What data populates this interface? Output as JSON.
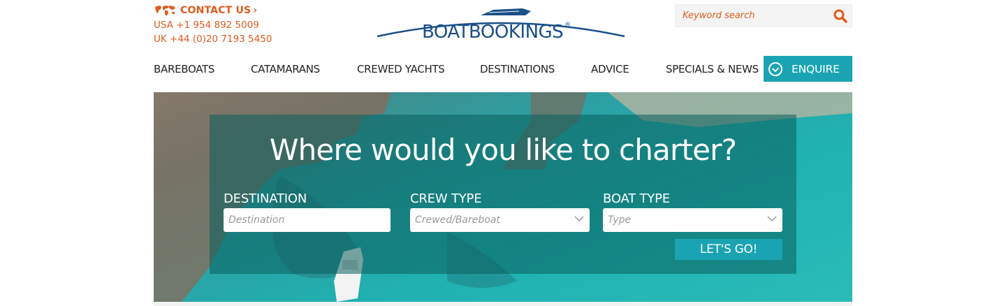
{
  "contact": {
    "icon": "world-map-icon",
    "label": "CONTACT US",
    "chevron": "›",
    "phone_usa": "USA +1 954 892 5009",
    "phone_uk": "UK +44 (0)20 7193 5450",
    "color": "#e05a1f"
  },
  "logo": {
    "text": "BOATBOOKINGS",
    "registered": "®",
    "color": "#1a4f8a"
  },
  "search": {
    "placeholder": "Keyword search",
    "icon": "search-icon"
  },
  "nav": {
    "items": [
      "BAREBOATS",
      "CATAMARANS",
      "CREWED YACHTS",
      "DESTINATIONS",
      "ADVICE",
      "SPECIALS & NEWS"
    ],
    "enquire": {
      "label": "ENQUIRE",
      "icon": "check-circle-icon",
      "color": "#1aa3b3"
    }
  },
  "hero": {
    "headline": "Where would you like to charter?",
    "destination": {
      "label": "DESTINATION",
      "placeholder": "Destination"
    },
    "crew_type": {
      "label": "CREW TYPE",
      "placeholder": "Crewed/Bareboat"
    },
    "boat_type": {
      "label": "BOAT TYPE",
      "placeholder": "Type"
    },
    "submit": "LET'S GO!"
  }
}
